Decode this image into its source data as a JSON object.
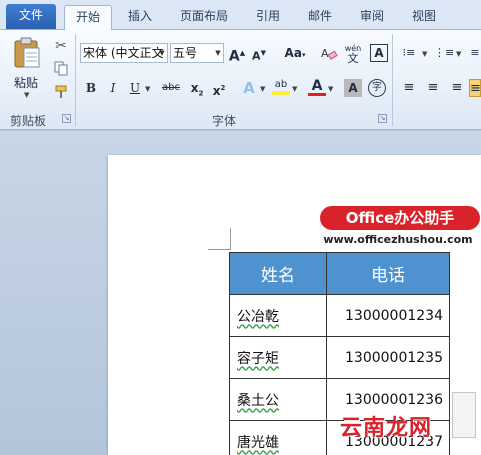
{
  "tabs": [
    {
      "label": "文件"
    },
    {
      "label": "开始"
    },
    {
      "label": "插入"
    },
    {
      "label": "页面布局"
    },
    {
      "label": "引用"
    },
    {
      "label": "邮件"
    },
    {
      "label": "审阅"
    },
    {
      "label": "视图"
    }
  ],
  "ribbon": {
    "clipboard": {
      "paste_label": "粘贴",
      "group_label": "剪贴板"
    },
    "font": {
      "font_name": "宋体 (中文正文",
      "font_size": "五号",
      "group_label": "字体"
    }
  },
  "watermark": {
    "badge": "Office办公助手",
    "url": "www.officezhushou.com"
  },
  "table": {
    "headers": [
      "姓名",
      "电话"
    ],
    "rows": [
      [
        "公冶乾",
        "13000001234"
      ],
      [
        "容子矩",
        "13000001235"
      ],
      [
        "桑土公",
        "13000001236"
      ],
      [
        "唐光雄",
        "13000001237"
      ]
    ]
  },
  "brand": {
    "text": "云南龙网"
  },
  "colors": {
    "header_fill": "#4f92d0",
    "badge_red": "#d8232a",
    "file_tab": "#2b5fb0"
  }
}
